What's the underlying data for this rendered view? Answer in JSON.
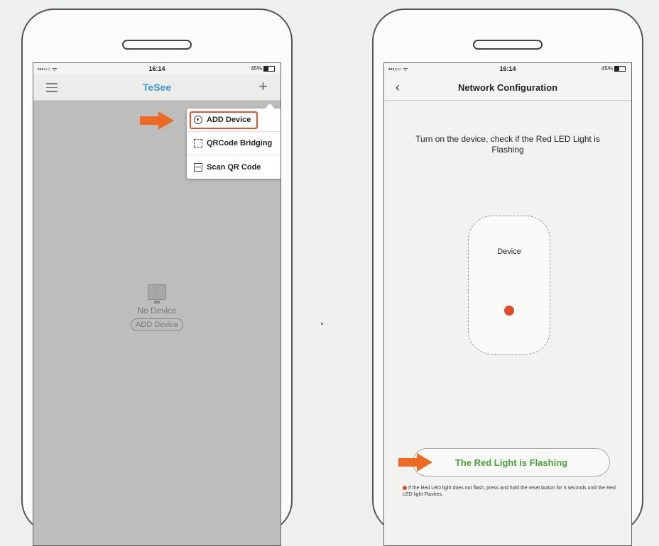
{
  "left_phone": {
    "status": {
      "signal": "•••○○ ᯤ",
      "time": "16:14",
      "battery": "45%"
    },
    "app_title": "TeSee",
    "menu": [
      {
        "label": "ADD Device",
        "icon": "add-circle-icon"
      },
      {
        "label": "QRCode Bridging",
        "icon": "qrcode-icon"
      },
      {
        "label": "Scan QR Code",
        "icon": "scan-icon"
      }
    ],
    "empty_text": "No Device",
    "empty_button": "ADD Device"
  },
  "right_phone": {
    "status": {
      "signal": "•••○○ ᯤ",
      "time": "16:14",
      "battery": "45%"
    },
    "nav_title": "Network Configuration",
    "instruction": "Turn on the device, check if the Red LED Light is Flashing",
    "device_label": "Device",
    "confirm_button": "The Red Light is Flashing",
    "note": "If the Red LED light does not flash, press and hold the reset button for 5 seconds until the Red LED light Flashes."
  },
  "colors": {
    "accent_blue": "#3e9bd1",
    "arrow_orange": "#ec6a22",
    "led_red": "#e04a2a",
    "confirm_green": "#4aa33a"
  }
}
